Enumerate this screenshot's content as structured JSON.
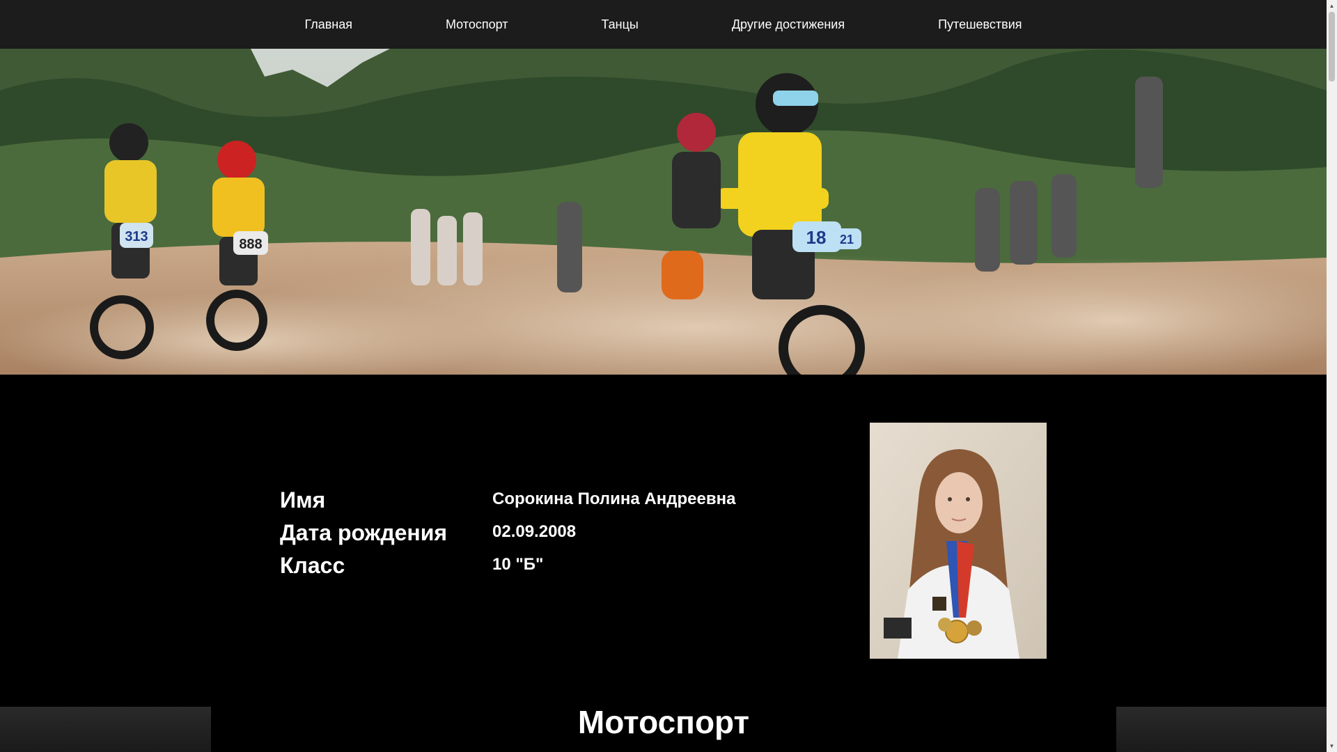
{
  "nav": {
    "items": [
      {
        "label": "Главная"
      },
      {
        "label": "Мотоспорт"
      },
      {
        "label": "Танцы"
      },
      {
        "label": "Другие достижения"
      },
      {
        "label": "Путешевствия"
      }
    ]
  },
  "profile": {
    "rows": [
      {
        "label": "Имя",
        "value": "Сорокина Полина Андреевна"
      },
      {
        "label": "Дата рождения",
        "value": "02.09.2008"
      },
      {
        "label": "Класс",
        "value": "10 \"Б\""
      }
    ]
  },
  "hero": {
    "bib_numbers": [
      "313",
      "888",
      "18",
      "21"
    ]
  },
  "section": {
    "title": "Мотоспорт"
  },
  "colors": {
    "nav_bg": "#1c1c1c",
    "page_bg": "#000000",
    "text": "#ffffff"
  },
  "icons": {
    "scroll_up": "triangle-up-icon",
    "scroll_down": "triangle-down-icon"
  }
}
